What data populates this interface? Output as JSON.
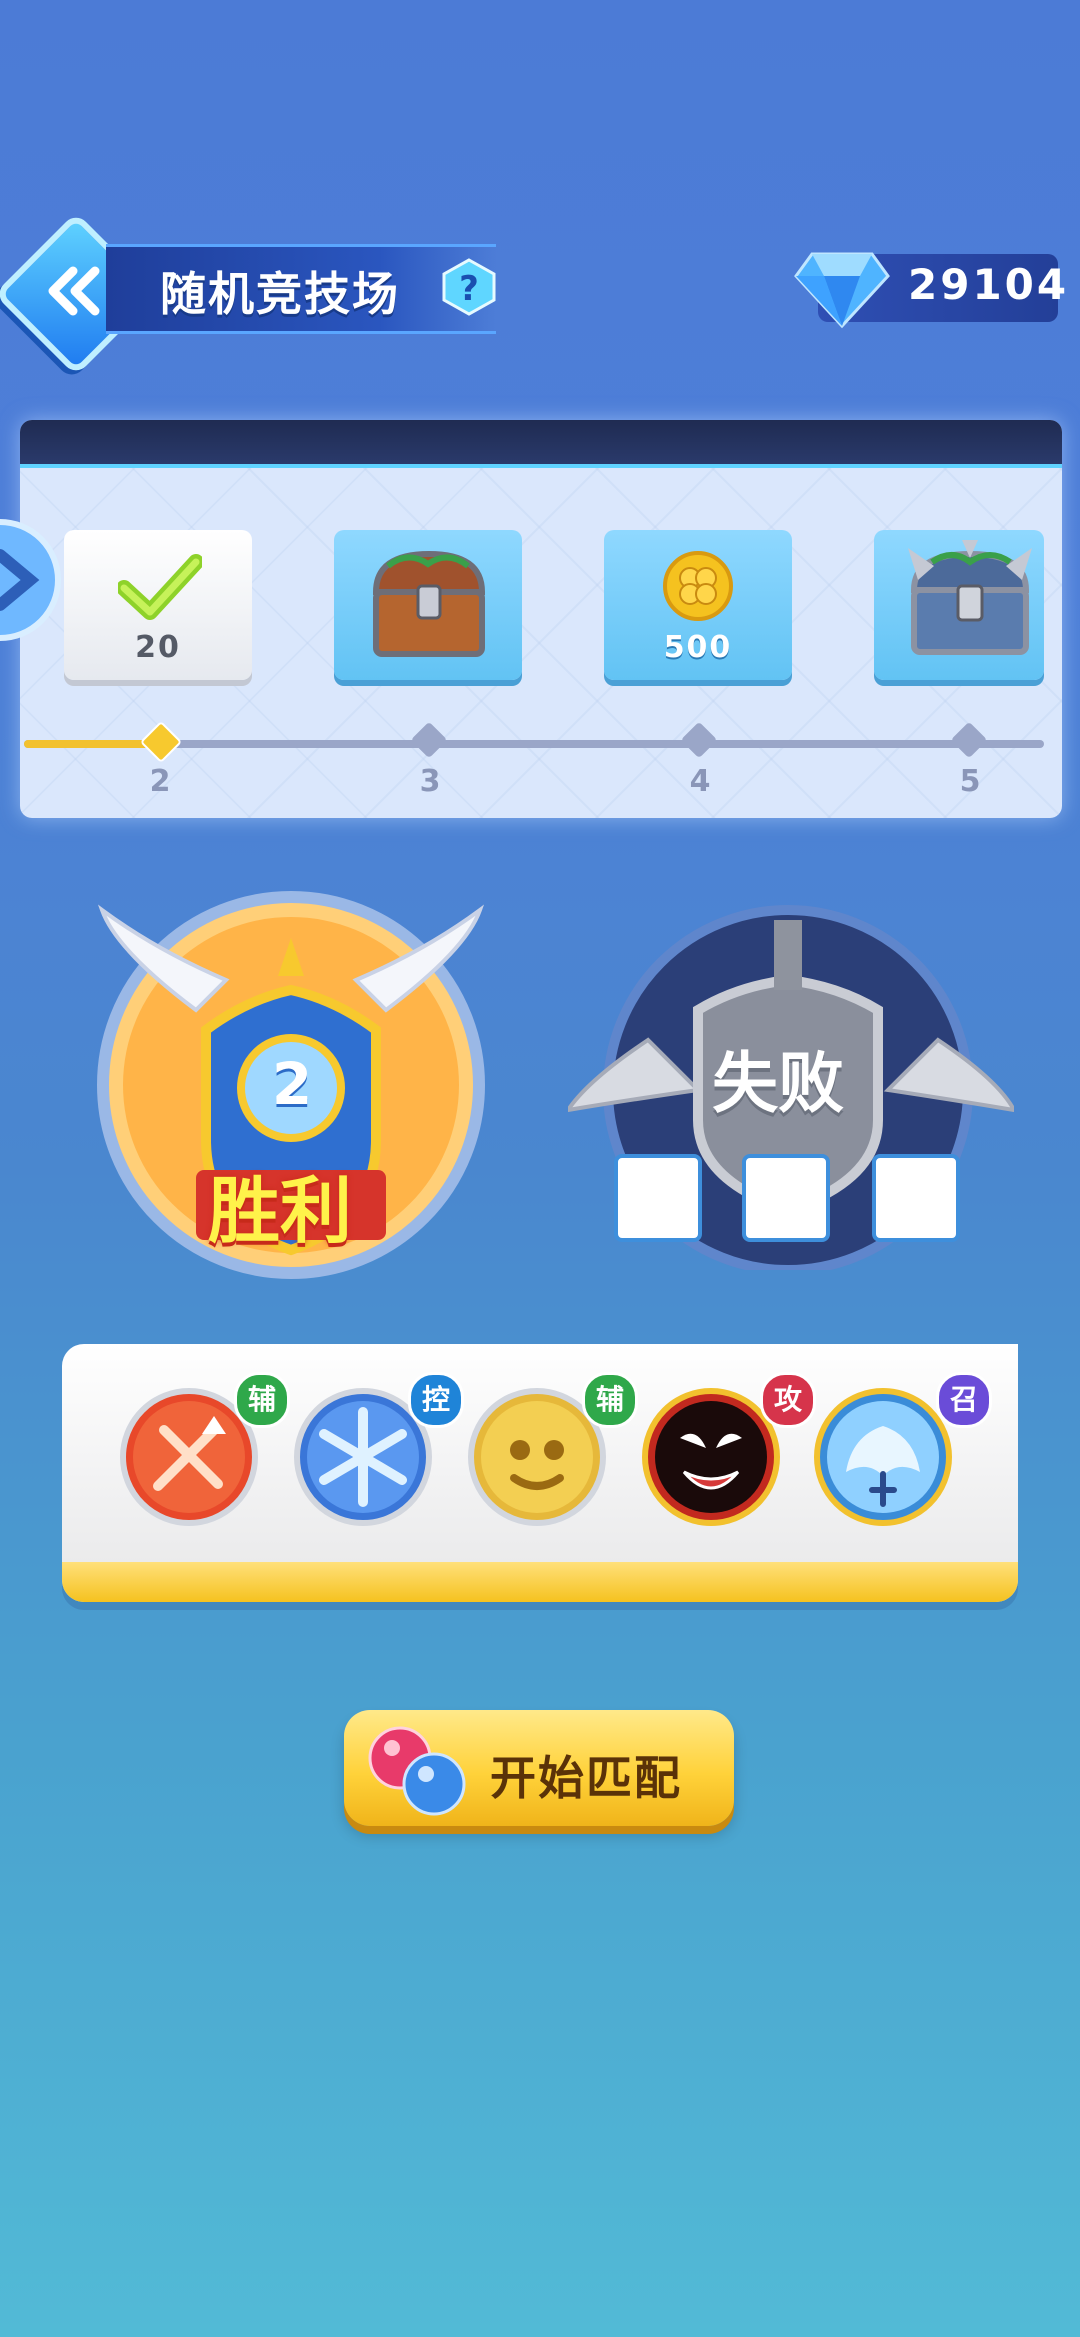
{
  "header": {
    "title": "随机竞技场",
    "help_icon": "question-icon",
    "back_icon": "double-chevron-left-icon",
    "gems": "29104"
  },
  "track": {
    "rewards": [
      {
        "label": "20",
        "icon": "check-icon",
        "claimed": true
      },
      {
        "label": "",
        "icon": "treasure-chest-icon",
        "claimed": false
      },
      {
        "label": "500",
        "icon": "clover-coin-icon",
        "claimed": false
      },
      {
        "label": "",
        "icon": "spiked-chest-icon",
        "claimed": false
      }
    ],
    "nodes": [
      "2",
      "3",
      "4",
      "5"
    ],
    "progress_fraction": 0.13
  },
  "result": {
    "win_label": "胜利",
    "win_count": "2",
    "lose_label": "失败"
  },
  "skills": [
    {
      "tag": "辅",
      "tag_color": "#2fa84a",
      "icon": "sword-buff-icon"
    },
    {
      "tag": "控",
      "tag_color": "#1f84d8",
      "icon": "snowflake-icon"
    },
    {
      "tag": "辅",
      "tag_color": "#2fa84a",
      "icon": "golden-face-icon"
    },
    {
      "tag": "攻",
      "tag_color": "#d6344b",
      "icon": "venom-icon"
    },
    {
      "tag": "召",
      "tag_color": "#6a4cd8",
      "icon": "angel-wings-icon"
    }
  ],
  "start_button": {
    "label": "开始匹配"
  },
  "colors": {
    "accent_yellow": "#ffd23a",
    "track_progress": "#f2c12e",
    "bg_top": "#4c7bd6",
    "bg_bottom": "#52bad6"
  }
}
